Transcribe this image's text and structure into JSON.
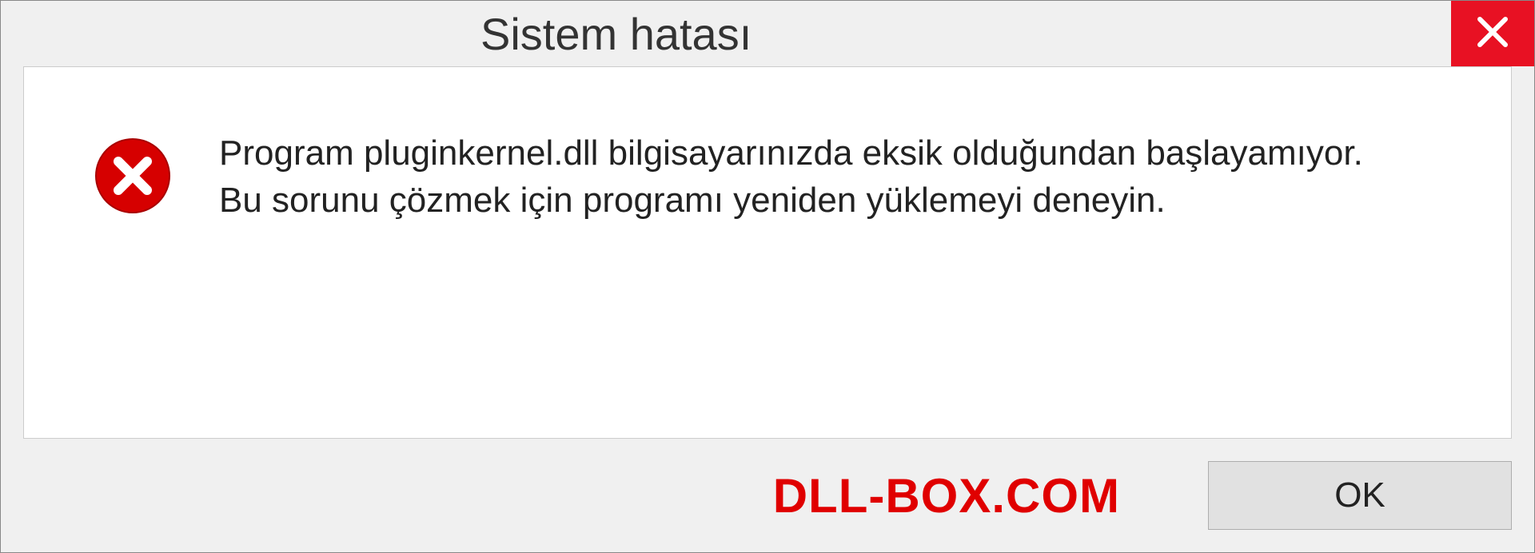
{
  "titlebar": {
    "title": "Sistem hatası"
  },
  "message": {
    "text": "Program pluginkernel.dll bilgisayarınızda eksik olduğundan başlayamıyor. Bu sorunu çözmek için programı yeniden yüklemeyi deneyin."
  },
  "footer": {
    "watermark": "DLL-BOX.COM",
    "ok_label": "OK"
  },
  "icons": {
    "close": "close-icon",
    "error": "error-icon"
  },
  "colors": {
    "close_bg": "#e81123",
    "error_bg": "#d60000",
    "watermark": "#e00000"
  }
}
